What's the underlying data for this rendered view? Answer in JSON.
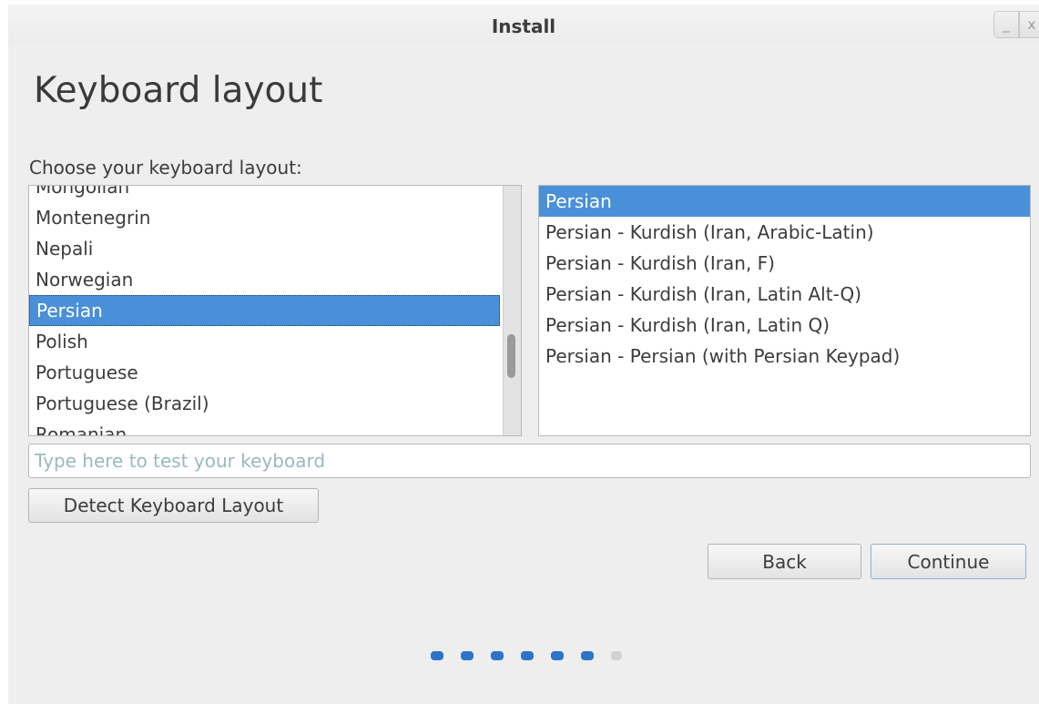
{
  "window": {
    "title": "Install",
    "minimize_glyph": "_",
    "close_glyph": "x"
  },
  "page": {
    "heading": "Keyboard layout",
    "prompt": "Choose your keyboard layout:"
  },
  "layouts": {
    "items": [
      "Mongolian",
      "Montenegrin",
      "Nepali",
      "Norwegian",
      "Persian",
      "Polish",
      "Portuguese",
      "Portuguese (Brazil)",
      "Romanian"
    ],
    "selected": "Persian"
  },
  "variants": {
    "items": [
      "Persian",
      "Persian - Kurdish (Iran, Arabic-Latin)",
      "Persian - Kurdish (Iran, F)",
      "Persian - Kurdish (Iran, Latin Alt-Q)",
      "Persian - Kurdish (Iran, Latin Q)",
      "Persian - Persian (with Persian Keypad)"
    ],
    "selected": "Persian"
  },
  "test_field": {
    "value": "",
    "placeholder": "Type here to test your keyboard"
  },
  "buttons": {
    "detect": "Detect Keyboard Layout",
    "back": "Back",
    "continue": "Continue"
  },
  "progress": {
    "total_steps": 7,
    "completed_steps": 6
  },
  "colors": {
    "selection": "#4a90d9",
    "progress_active": "#2d74c9",
    "progress_inactive": "#d2d2d2"
  }
}
